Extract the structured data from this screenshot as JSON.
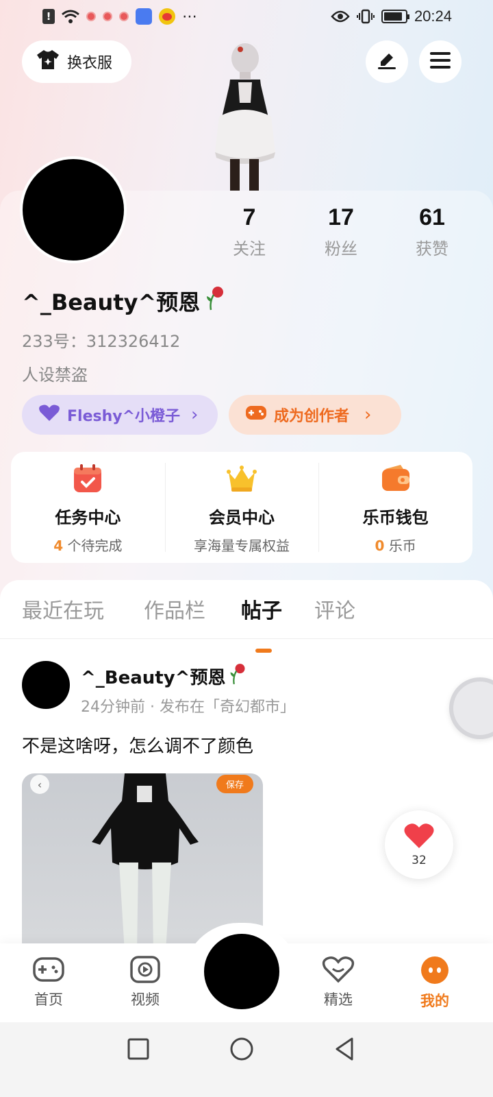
{
  "status_bar": {
    "time": "20:24"
  },
  "header": {
    "outfit_button_label": "换衣服"
  },
  "profile": {
    "username": "^_Beauty^预恩",
    "user_id": "233号：312326412",
    "bio": "人设禁盗",
    "stats": [
      {
        "value": "7",
        "label": "关注"
      },
      {
        "value": "17",
        "label": "粉丝"
      },
      {
        "value": "61",
        "label": "获赞"
      }
    ],
    "badges": [
      {
        "label": "Fleshy^小橙子",
        "arrow": "›"
      },
      {
        "label": "成为创作者",
        "arrow": "›"
      }
    ]
  },
  "services": [
    {
      "title": "任务中心",
      "sub_highlight": "4",
      "sub_text": "个待完成"
    },
    {
      "title": "会员中心",
      "sub_highlight": "",
      "sub_text": "享海量专属权益"
    },
    {
      "title": "乐币钱包",
      "sub_highlight": "0",
      "sub_text": "乐币"
    }
  ],
  "tabs": [
    {
      "label": "最近在玩"
    },
    {
      "label": "作品栏"
    },
    {
      "label": "帖子"
    },
    {
      "label": "评论"
    }
  ],
  "post": {
    "author": "^_Beauty^预恩",
    "meta": "24分钟前 · 发布在「奇幻都市」",
    "text": "不是这啥呀，怎么调不了颜色",
    "save_badge": "保存",
    "back_glyph": "‹",
    "like_count": "32"
  },
  "bottom_nav": [
    {
      "label": "首页"
    },
    {
      "label": "视频"
    },
    {
      "label": "精选"
    },
    {
      "label": "我的"
    }
  ],
  "colors": {
    "accent_orange": "#f07a1c",
    "badge_purple": "#7a5bd6",
    "badge_orange": "#ee6a1f"
  }
}
